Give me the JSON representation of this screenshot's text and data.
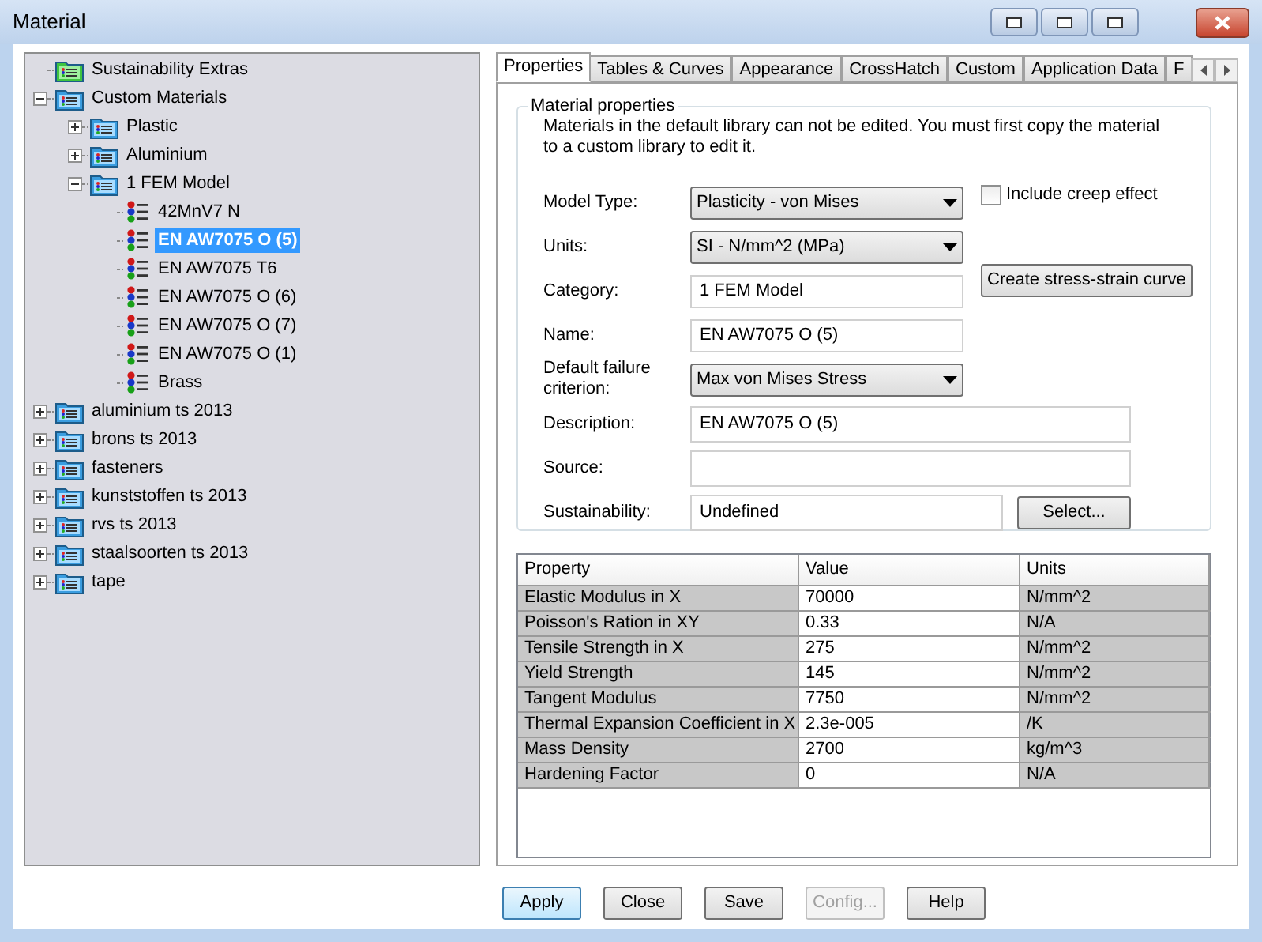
{
  "window": {
    "title": "Material"
  },
  "tree": [
    {
      "label": "Sustainability Extras",
      "kind": "green-folder",
      "selected": false
    },
    {
      "label": "Custom Materials",
      "kind": "folder",
      "selected": false,
      "expanded": true,
      "children": [
        {
          "label": "Plastic",
          "kind": "folder",
          "selected": false,
          "expanded": false
        },
        {
          "label": "Aluminium",
          "kind": "folder",
          "selected": false,
          "expanded": false
        },
        {
          "label": "1 FEM Model",
          "kind": "folder",
          "selected": false,
          "expanded": true,
          "children": [
            {
              "label": "42MnV7 N",
              "kind": "material",
              "selected": false
            },
            {
              "label": "EN AW7075 O (5)",
              "kind": "material",
              "selected": true
            },
            {
              "label": "EN AW7075 T6",
              "kind": "material",
              "selected": false
            },
            {
              "label": "EN AW7075 O (6)",
              "kind": "material",
              "selected": false
            },
            {
              "label": "EN AW7075 O (7)",
              "kind": "material",
              "selected": false
            },
            {
              "label": "EN AW7075 O (1)",
              "kind": "material",
              "selected": false
            },
            {
              "label": "Brass",
              "kind": "material",
              "selected": false
            }
          ]
        }
      ]
    },
    {
      "label": "aluminium ts 2013",
      "kind": "folder",
      "selected": false,
      "expanded": false
    },
    {
      "label": "brons ts 2013",
      "kind": "folder",
      "selected": false,
      "expanded": false
    },
    {
      "label": "fasteners",
      "kind": "folder",
      "selected": false,
      "expanded": false
    },
    {
      "label": "kunststoffen ts 2013",
      "kind": "folder",
      "selected": false,
      "expanded": false
    },
    {
      "label": "rvs ts 2013",
      "kind": "folder",
      "selected": false,
      "expanded": false
    },
    {
      "label": "staalsoorten ts 2013",
      "kind": "folder",
      "selected": false,
      "expanded": false
    },
    {
      "label": "tape",
      "kind": "folder",
      "selected": false,
      "expanded": false
    }
  ],
  "tabs": [
    {
      "label": "Properties",
      "selected": true
    },
    {
      "label": "Tables & Curves",
      "selected": false
    },
    {
      "label": "Appearance",
      "selected": false
    },
    {
      "label": "CrossHatch",
      "selected": false
    },
    {
      "label": "Custom",
      "selected": false
    },
    {
      "label": "Application Data",
      "selected": false
    },
    {
      "label": "F",
      "selected": false
    }
  ],
  "group": {
    "title": "Material properties",
    "note": "Materials in the default library can not be edited. You must first copy the material to a custom library to edit it.",
    "fields": [
      {
        "label": "Model Type:",
        "kind": "select",
        "value": "Plasticity - von Mises"
      },
      {
        "label": "Units:",
        "kind": "select",
        "value": "SI - N/mm^2 (MPa)"
      },
      {
        "label": "Category:",
        "kind": "text",
        "value": "1 FEM Model"
      },
      {
        "label": "Name:",
        "kind": "text",
        "value": "EN AW7075 O (5)"
      },
      {
        "label": "Default failure criterion:",
        "kind": "select",
        "value": "Max von Mises Stress"
      },
      {
        "label": "Description:",
        "kind": "wide",
        "value": "EN AW7075 O (5)"
      },
      {
        "label": "Source:",
        "kind": "wide"
      },
      {
        "label": "Sustainability:",
        "kind": "picker",
        "value": "Undefined",
        "button": "Select..."
      }
    ],
    "creep": {
      "label": "Include creep effect",
      "checked": false
    },
    "curve_button": "Create stress-strain curve"
  },
  "table": {
    "columns": [
      "Property",
      "Value",
      "Units"
    ],
    "rows": [
      [
        "Elastic Modulus in X",
        "70000",
        "N/mm^2"
      ],
      [
        "Poisson's Ration in XY",
        "0.33",
        "N/A"
      ],
      [
        "Tensile Strength in X",
        "275",
        "N/mm^2"
      ],
      [
        "Yield Strength",
        "145",
        "N/mm^2"
      ],
      [
        "Tangent Modulus",
        "7750",
        "N/mm^2"
      ],
      [
        "Thermal Expansion Coefficient in X",
        "2.3e-005",
        "/K"
      ],
      [
        "Mass Density",
        "2700",
        "kg/m^3"
      ],
      [
        "Hardening Factor",
        "0",
        "N/A"
      ]
    ]
  },
  "buttons": [
    {
      "label": "Apply",
      "default": true,
      "disabled": false
    },
    {
      "label": "Close",
      "default": false,
      "disabled": false
    },
    {
      "label": "Save",
      "default": false,
      "disabled": false
    },
    {
      "label": "Config...",
      "default": false,
      "disabled": true
    },
    {
      "label": "Help",
      "default": false,
      "disabled": false
    }
  ]
}
